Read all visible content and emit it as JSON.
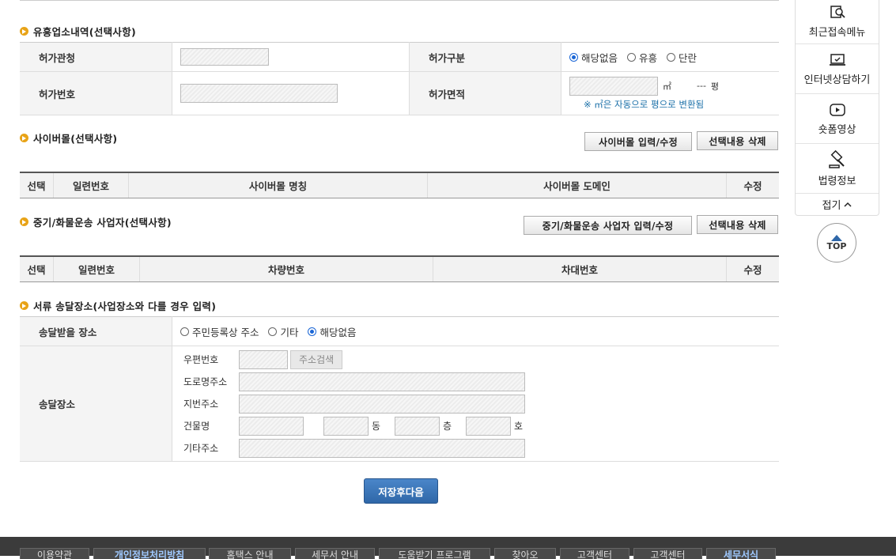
{
  "permit_section": {
    "title": "유흥업소내역(선택사항)",
    "row1": {
      "label_left": "허가관청",
      "label_right": "허가구분",
      "radios": [
        "해당없음",
        "유흥",
        "단란"
      ],
      "selected": "해당없음"
    },
    "row2": {
      "label_left": "허가번호",
      "label_right": "허가면적",
      "unit_m2": "㎡",
      "pyeong_value": "---",
      "unit_pyeong": "평",
      "note": "※ ㎡은 자동으로 평으로 변환됨"
    }
  },
  "cybermall_section": {
    "title": "사이버몰(선택사항)",
    "btn_input": "사이버몰 입력/수정",
    "btn_delete": "선택내용 삭제",
    "columns": [
      "선택",
      "일련번호",
      "사이버몰 명칭",
      "사이버몰 도메인",
      "수정"
    ]
  },
  "freight_section": {
    "title": "중기/화물운송 사업자(선택사항)",
    "btn_input": "중기/화물운송 사업자 입력/수정",
    "btn_delete": "선택내용 삭제",
    "columns": [
      "선택",
      "일련번호",
      "차량번호",
      "차대번호",
      "수정"
    ]
  },
  "delivery_section": {
    "title": "서류 송달장소(사업장소와 다를 경우 입력)",
    "place_label": "송달받을 장소",
    "radios": [
      "주민등록상 주소",
      "기타",
      "해당없음"
    ],
    "selected": "해당없음",
    "address_label": "송달장소",
    "postal_label": "우편번호",
    "search_btn": "주소검색",
    "road_label": "도로명주소",
    "jibun_label": "지번주소",
    "building_label": "건물명",
    "dong": "동",
    "floor": "층",
    "ho": "호",
    "etc_label": "기타주소"
  },
  "save_button": "저장후다음",
  "sidebar": {
    "items": [
      {
        "label": "최근접속메뉴",
        "icon": "recent-search-icon"
      },
      {
        "label": "인터넷상담하기",
        "icon": "laptop-check-icon"
      },
      {
        "label": "숏폼영상",
        "icon": "play-icon"
      },
      {
        "label": "법령정보",
        "icon": "gavel-icon"
      }
    ],
    "fold": "접기",
    "top": "TOP"
  },
  "footer_tabs": [
    "이용약관",
    "개인정보처리방침",
    "홈택스 안내",
    "세무서 안내",
    "도움받기 프로그램",
    "찾아오",
    "고객센터",
    "고객센터",
    "세무서식"
  ]
}
